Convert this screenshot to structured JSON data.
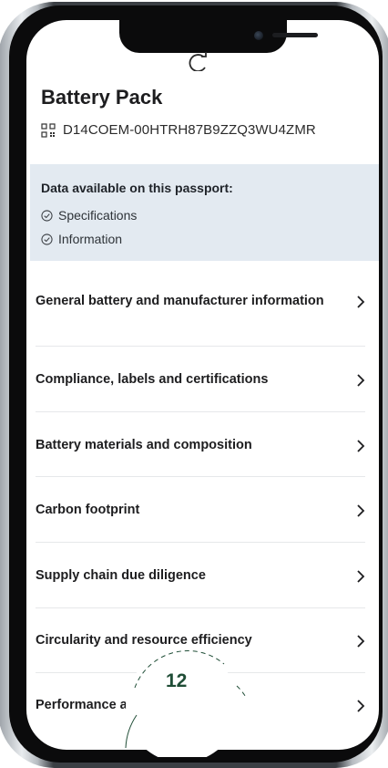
{
  "app": {
    "title": "Battery Pack",
    "passport_id": "D14COEM-00HTRH87B9ZZQ3WU4ZMR"
  },
  "data_panel": {
    "heading": "Data available on this passport:",
    "items": [
      "Specifications",
      "Information"
    ]
  },
  "menu": {
    "items": [
      {
        "label": "General battery and manufacturer information"
      },
      {
        "label": "Compliance, labels and certifications"
      },
      {
        "label": "Battery materials and composition"
      },
      {
        "label": "Carbon footprint"
      },
      {
        "label": "Supply chain due diligence"
      },
      {
        "label": "Circularity and resource efficiency"
      },
      {
        "label": "Performance ar"
      }
    ]
  },
  "badge": {
    "number": "12"
  },
  "colors": {
    "panel_bg": "#e3eaf1",
    "badge_dot": "#9ac53a",
    "badge_text": "#1f4d36"
  }
}
